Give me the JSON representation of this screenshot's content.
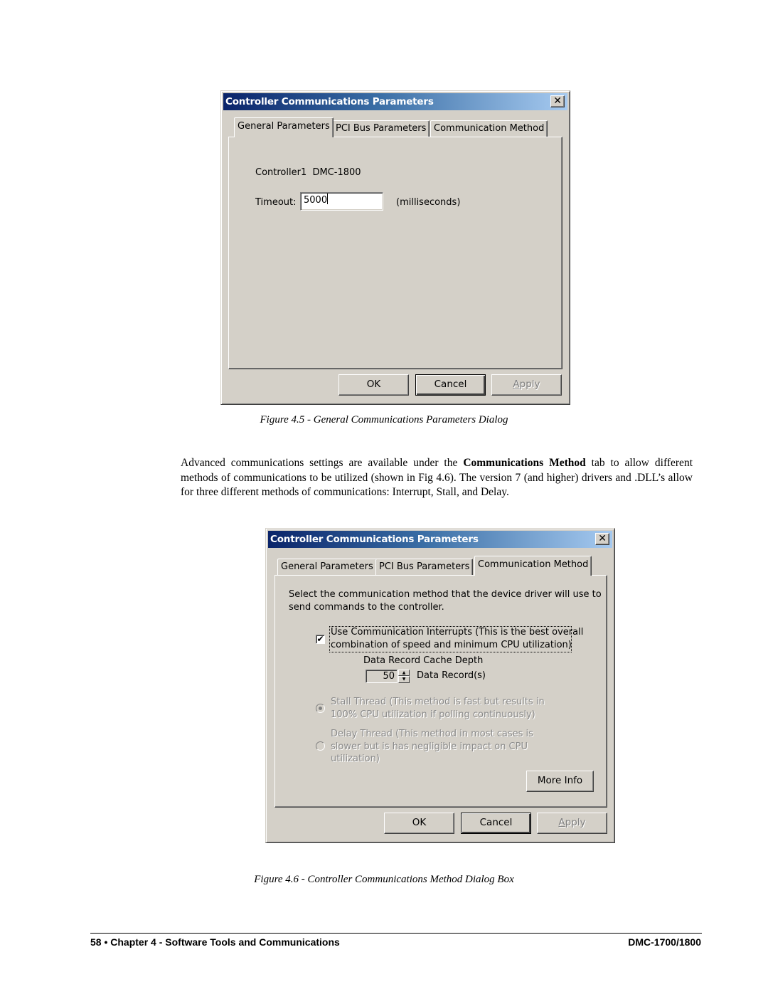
{
  "figure1": {
    "title": "Controller Communications Parameters",
    "close_glyph": "✕",
    "tabs": [
      {
        "label": "General Parameters",
        "active": true
      },
      {
        "label": "PCI Bus Parameters",
        "active": false
      },
      {
        "label": "Communication Method",
        "active": false
      }
    ],
    "controller_label": "Controller1  DMC-1800",
    "timeout_label": "Timeout:",
    "timeout_value": "5000",
    "timeout_units": "(milliseconds)",
    "buttons": {
      "ok": "OK",
      "cancel": "Cancel",
      "apply_first": "A",
      "apply_rest": "pply"
    },
    "caption": "Figure 4.5 - General Communications Parameters Dialog"
  },
  "paragraph": {
    "part1": "Advanced communications settings are available under the ",
    "bold": "Communications Method",
    "part2": " tab to allow different methods of communications to be utilized (shown in Fig 4.6). The version 7 (and higher) drivers and .DLL’s allow for three different methods of communications: Interrupt, Stall, and Delay."
  },
  "figure2": {
    "title": "Controller Communications Parameters",
    "close_glyph": "✕",
    "tabs": [
      {
        "label": "General Parameters",
        "active": false
      },
      {
        "label": "PCI Bus Parameters",
        "active": false
      },
      {
        "label": "Communication Method",
        "active": true
      }
    ],
    "instructions_line1": "Select the communication method that the device driver will use to",
    "instructions_line2": "send commands to the controller.",
    "interrupts": {
      "checked": true,
      "check_glyph": "✔",
      "line1": "Use Communication Interrupts (This is the best overall",
      "line2": "combination of speed and minimum CPU utilization)"
    },
    "cache_depth_label": "Data Record Cache Depth",
    "cache_depth_value": "50",
    "cache_depth_units": "Data Record(s)",
    "stall": {
      "selected": true,
      "enabled": false,
      "line1": "Stall Thread (This method is fast but results in",
      "line2": "100% CPU utilization if polling continuously)"
    },
    "delay": {
      "selected": false,
      "enabled": false,
      "line1": "Delay Thread (This method in most cases is",
      "line2": "slower but is has negligible impact on CPU",
      "line3": "utilization)"
    },
    "more_info": "More Info",
    "buttons": {
      "ok": "OK",
      "cancel": "Cancel",
      "apply_first": "A",
      "apply_rest": "pply"
    },
    "caption": "Figure 4.6 - Controller Communications Method Dialog Box"
  },
  "footer": {
    "left": "58 • Chapter 4 - Software Tools and Communications",
    "right": "DMC-1700/1800"
  }
}
